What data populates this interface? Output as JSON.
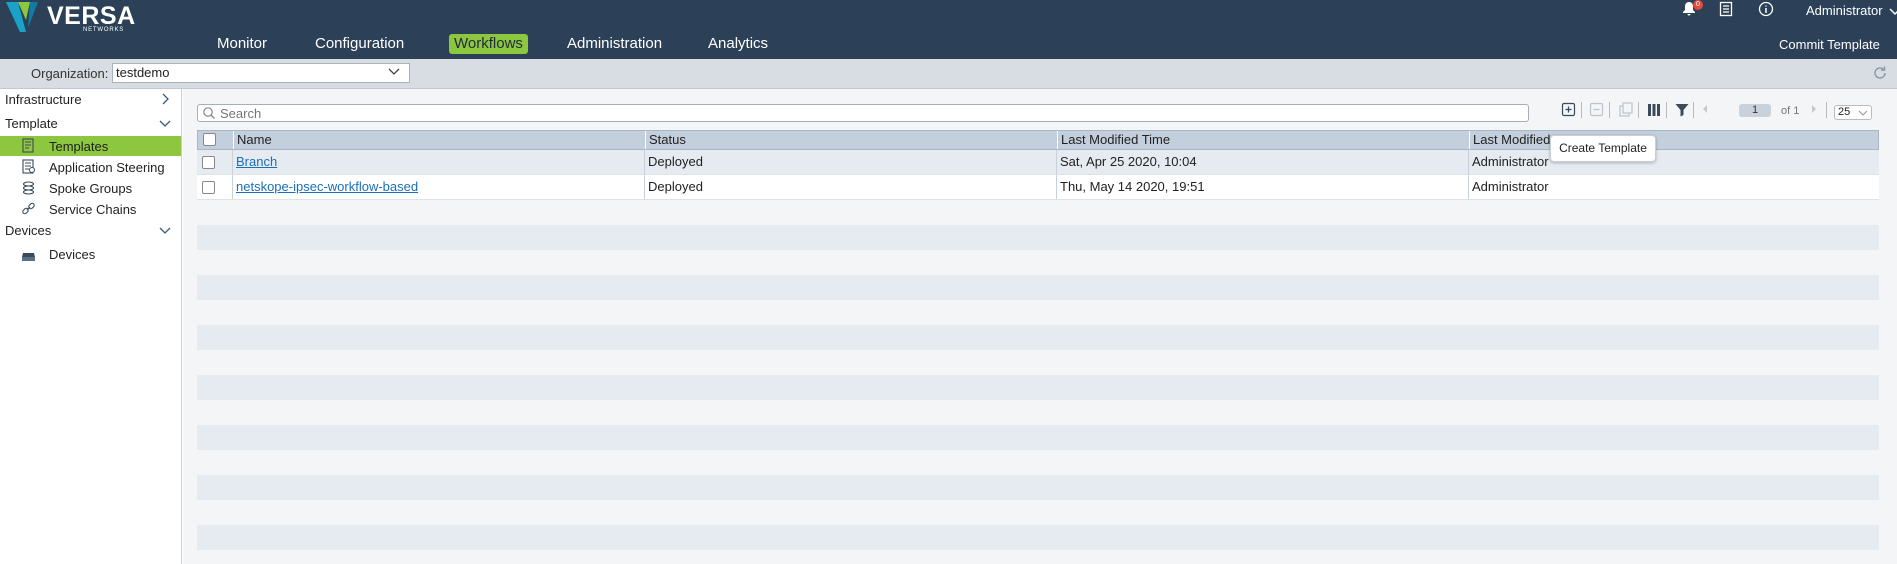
{
  "brand": {
    "name": "VERSA",
    "sub": "NETWORKS"
  },
  "nav": [
    {
      "label": "Monitor"
    },
    {
      "label": "Configuration"
    },
    {
      "label": "Workflows",
      "active": true
    },
    {
      "label": "Administration"
    },
    {
      "label": "Analytics"
    }
  ],
  "header": {
    "user": "Administrator",
    "notifications": "0",
    "commit_label": "Commit Template"
  },
  "org": {
    "label": "Organization:",
    "value": "testdemo"
  },
  "sidebar": {
    "groups": [
      {
        "label": "Infrastructure",
        "expanded": false
      },
      {
        "label": "Template",
        "expanded": true,
        "items": [
          {
            "label": "Templates",
            "active": true,
            "icon": "template-icon"
          },
          {
            "label": "Application Steering",
            "icon": "app-steering-icon"
          },
          {
            "label": "Spoke Groups",
            "icon": "spoke-groups-icon"
          },
          {
            "label": "Service Chains",
            "icon": "service-chain-icon"
          }
        ]
      },
      {
        "label": "Devices",
        "expanded": true,
        "items": [
          {
            "label": "Devices",
            "icon": "devices-icon"
          }
        ]
      }
    ]
  },
  "search": {
    "placeholder": "Search"
  },
  "pager": {
    "page": "1",
    "of_label": "of 1",
    "page_size": "25"
  },
  "table": {
    "columns": [
      "Name",
      "Status",
      "Last Modified Time",
      "Last Modified"
    ],
    "rows": [
      {
        "name": "Branch",
        "status": "Deployed",
        "modified_time": "Sat, Apr 25 2020, 10:04",
        "modified_by": "Administrator"
      },
      {
        "name": "netskope-ipsec-workflow-based",
        "status": "Deployed",
        "modified_time": "Thu, May 14 2020, 19:51",
        "modified_by": "Administrator"
      }
    ]
  },
  "tooltip": {
    "text": "Create Template"
  },
  "colors": {
    "header_bg": "#2c4057",
    "accent": "#8dc63f",
    "link": "#1a6fb8"
  }
}
